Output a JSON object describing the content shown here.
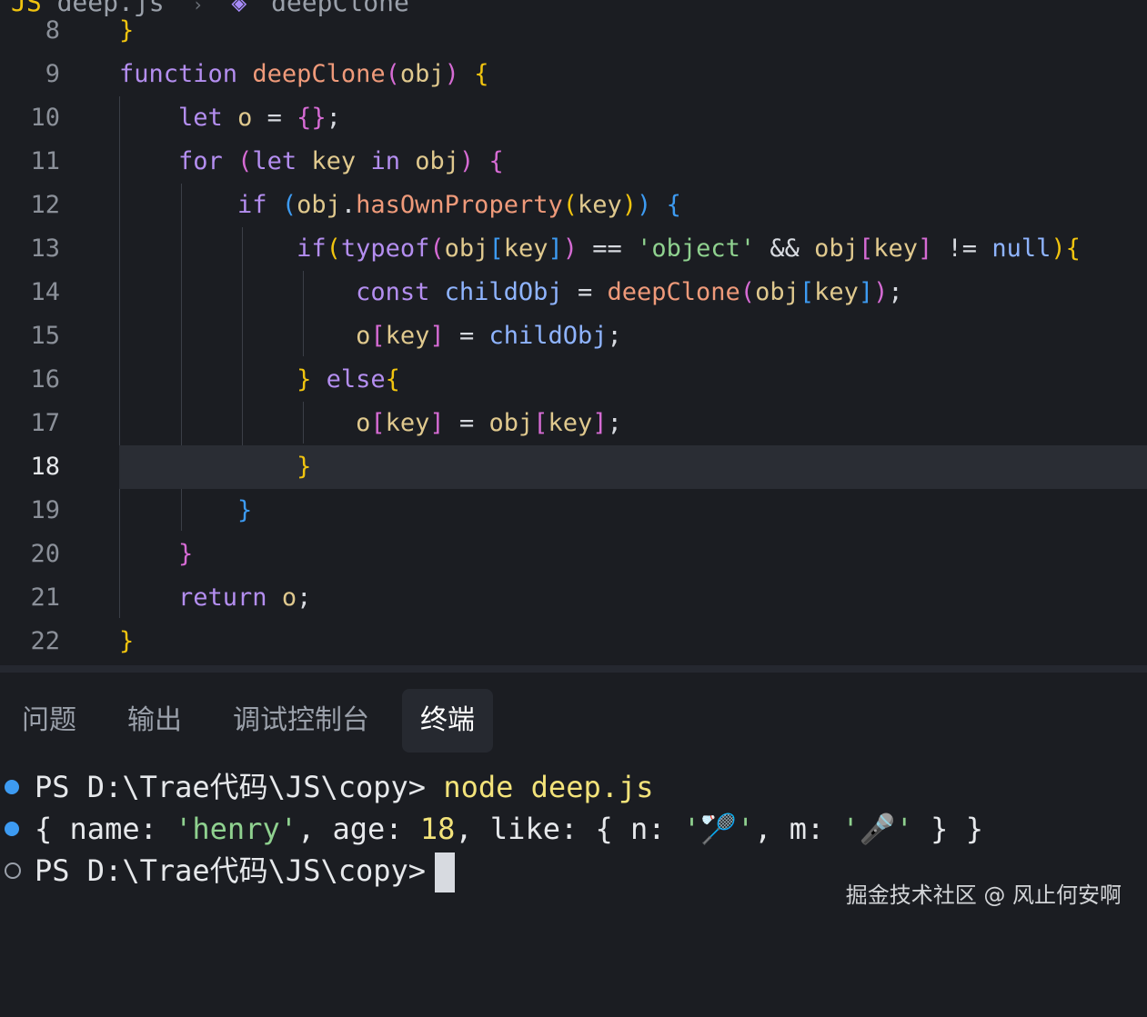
{
  "breadcrumb": {
    "file": "deep.js",
    "symbol": "deepClone"
  },
  "editor": {
    "current_line": "18",
    "lines": [
      {
        "no": "8"
      },
      {
        "no": "9"
      },
      {
        "no": "10"
      },
      {
        "no": "11"
      },
      {
        "no": "12"
      },
      {
        "no": "13"
      },
      {
        "no": "14"
      },
      {
        "no": "15"
      },
      {
        "no": "16"
      },
      {
        "no": "17"
      },
      {
        "no": "18"
      },
      {
        "no": "19"
      },
      {
        "no": "20"
      },
      {
        "no": "21"
      },
      {
        "no": "22"
      }
    ],
    "code": {
      "l8_brace": "}",
      "l9_kw": "function",
      "l9_fn": "deepClone",
      "l9_open": "(",
      "l9_param": "obj",
      "l9_close": ")",
      "l9_brace": "{",
      "l10_kw": "let",
      "l10_var": "o",
      "l10_eq": "=",
      "l10_obj": "{}",
      "l10_semi": ";",
      "l11_kw": "for",
      "l11_open": "(",
      "l11_let": "let",
      "l11_key": "key",
      "l11_in": "in",
      "l11_obj": "obj",
      "l11_close": ")",
      "l11_brace": "{",
      "l12_kw": "if",
      "l12_open": "(",
      "l12_obj": "obj",
      "l12_dot": ".",
      "l12_method": "hasOwnProperty",
      "l12_p_open": "(",
      "l12_key": "key",
      "l12_p_close": ")",
      "l12_close": ")",
      "l12_brace": "{",
      "l13_kw": "if",
      "l13_open": "(",
      "l13_typeof": "typeof",
      "l13_t_open": "(",
      "l13_obj": "obj",
      "l13_b_open": "[",
      "l13_key": "key",
      "l13_b_close": "]",
      "l13_t_close": ")",
      "l13_eq": "==",
      "l13_str": "'object'",
      "l13_and": "&&",
      "l13_obj2": "obj",
      "l13_b2_open": "[",
      "l13_key2": "key",
      "l13_b2_close": "]",
      "l13_neq": "!=",
      "l13_null": "null",
      "l13_close": ")",
      "l13_brace": "{",
      "l14_kw": "const",
      "l14_var": "childObj",
      "l14_eq": "=",
      "l14_fn": "deepClone",
      "l14_open": "(",
      "l14_obj": "obj",
      "l14_b_open": "[",
      "l14_key": "key",
      "l14_b_close": "]",
      "l14_close": ")",
      "l14_semi": ";",
      "l15_o": "o",
      "l15_b_open": "[",
      "l15_key": "key",
      "l15_b_close": "]",
      "l15_eq": "=",
      "l15_var": "childObj",
      "l15_semi": ";",
      "l16_brace": "}",
      "l16_else": "else",
      "l16_brace2": "{",
      "l17_o": "o",
      "l17_b_open": "[",
      "l17_key": "key",
      "l17_b_close": "]",
      "l17_eq": "=",
      "l17_obj": "obj",
      "l17_b2_open": "[",
      "l17_key2": "key",
      "l17_b2_close": "]",
      "l17_semi": ";",
      "l18_brace": "}",
      "l19_brace": "}",
      "l20_brace": "}",
      "l21_kw": "return",
      "l21_var": "o",
      "l21_semi": ";",
      "l22_brace": "}"
    }
  },
  "panel": {
    "tabs": [
      {
        "label": "问题"
      },
      {
        "label": "输出"
      },
      {
        "label": "调试控制台"
      },
      {
        "label": "终端"
      }
    ],
    "active_tab": "终端",
    "terminal": {
      "prompt": "PS D:\\Trae代码\\JS\\copy>",
      "command": "node deep.js",
      "out_open": "{",
      "out_name_key": "name:",
      "out_name_val": "'henry'",
      "out_comma1": ",",
      "out_age_key": "age:",
      "out_age_val": "18",
      "out_comma2": ",",
      "out_like_key": "like:",
      "out_like_open": "{",
      "out_n_key": "n:",
      "out_n_val": "'🏸'",
      "out_comma3": ",",
      "out_m_key": "m:",
      "out_m_val": "'🎤'",
      "out_like_close": "}",
      "out_close": "}"
    }
  },
  "watermark": "掘金技术社区 @ 风止何安啊",
  "colors": {
    "background": "#1b1d22",
    "keyword": "#b48ef0",
    "function": "#ef9a7a",
    "variable": "#e0c98e",
    "string": "#8fd18f",
    "bracket1": "#f1c40f",
    "bracket2": "#d66bd4",
    "bracket3": "#3d9bf2"
  }
}
